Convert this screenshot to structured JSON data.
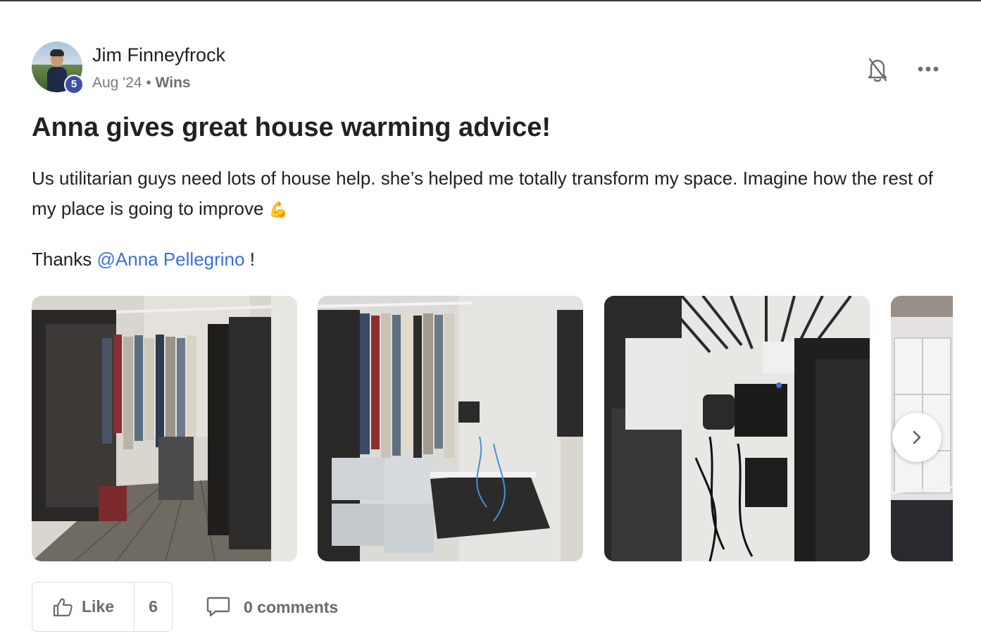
{
  "post": {
    "author": "Jim Finneyfrock",
    "level": "5",
    "date": "Aug '24",
    "separator": "•",
    "category": "Wins",
    "title": "Anna gives great house warming advice!",
    "body": "Us utilitarian guys need lots of house help. she’s helped me totally transform my space. Imagine how the rest of my place is going to improve",
    "body_emoji": "💪",
    "thanks_prefix": "Thanks",
    "mention": "@Anna Pellegrino",
    "thanks_suffix": "!"
  },
  "header_icons": [
    "bell-off-icon",
    "more-horizontal-icon"
  ],
  "gallery": {
    "photos": [
      "closet-photo-1",
      "closet-photo-2",
      "closet-photo-3",
      "closet-photo-4"
    ],
    "next_icon": "chevron-right-icon"
  },
  "actions": {
    "like_label": "Like",
    "like_count": "6",
    "comments_label": "0 comments"
  },
  "colors": {
    "mention": "#3b6fe0",
    "level_badge": "#3f4fa8",
    "text": "#202124",
    "muted": "#7a7a7a"
  }
}
